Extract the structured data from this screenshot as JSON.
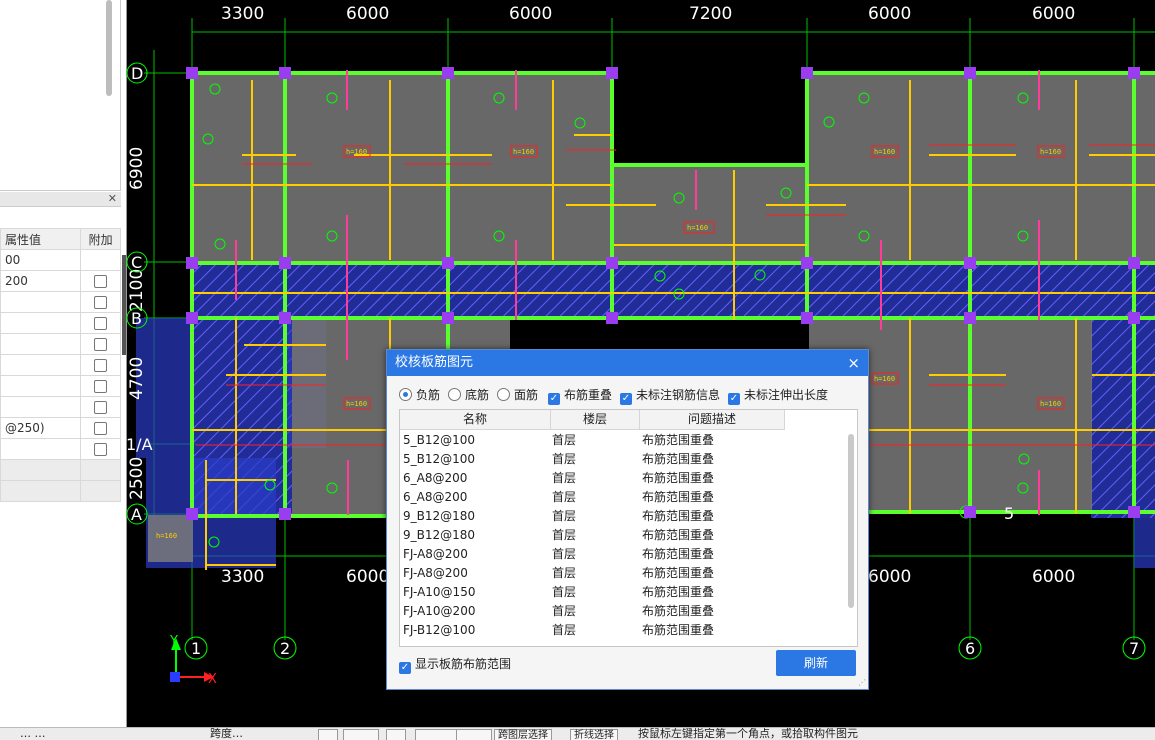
{
  "left_panel": {
    "header": {
      "value": "属性值",
      "extra": "附加"
    },
    "rows": [
      {
        "value": "00",
        "has_check": false
      },
      {
        "value": "200",
        "has_check": true
      },
      {
        "value": "",
        "has_check": true
      },
      {
        "value": "",
        "has_check": true
      },
      {
        "value": "",
        "has_check": true
      },
      {
        "value": "",
        "has_check": true
      },
      {
        "value": "",
        "has_check": true
      },
      {
        "value": "",
        "has_check": true
      },
      {
        "value": "@250)",
        "has_check": true
      },
      {
        "value": "",
        "has_check": true
      },
      {
        "value": "",
        "has_check": false
      },
      {
        "value": "",
        "has_check": false
      }
    ]
  },
  "drawing": {
    "top_dims": [
      "3300",
      "6000",
      "6000",
      "7200",
      "6000",
      "6000"
    ],
    "bottom_dims": [
      "3300",
      "6000",
      "6000",
      "6000"
    ],
    "left_dims": [
      "6900",
      "2100",
      "4700",
      "2500"
    ],
    "row_axes": [
      "D",
      "C",
      "B",
      "1/A",
      "A"
    ],
    "col_axes": [
      "1",
      "2",
      "6",
      "7"
    ],
    "marker_5": "5",
    "axis_y": "Y",
    "axis_x": "X",
    "tag_h160": "h=160",
    "colors": {
      "background": "#000000",
      "slab": "#7a7a7a",
      "beam": "#5cff2e",
      "rebar": "#ffcc00",
      "dim_line": "#00ff00",
      "hatch": "#2a3cc8",
      "column": "#9a3cf0"
    }
  },
  "dialog": {
    "title": "校核板筋图元",
    "close_icon": "×",
    "radios": [
      {
        "label": "负筋",
        "selected": true
      },
      {
        "label": "底筋",
        "selected": false
      },
      {
        "label": "面筋",
        "selected": false
      }
    ],
    "checks": [
      {
        "label": "布筋重叠",
        "checked": true
      },
      {
        "label": "未标注钢筋信息",
        "checked": true
      },
      {
        "label": "未标注伸出长度",
        "checked": true
      }
    ],
    "columns": [
      "名称",
      "楼层",
      "问题描述"
    ],
    "rows": [
      {
        "name": "5_B12@100",
        "floor": "首层",
        "issue": "布筋范围重叠"
      },
      {
        "name": "5_B12@100",
        "floor": "首层",
        "issue": "布筋范围重叠"
      },
      {
        "name": "6_A8@200",
        "floor": "首层",
        "issue": "布筋范围重叠"
      },
      {
        "name": "6_A8@200",
        "floor": "首层",
        "issue": "布筋范围重叠"
      },
      {
        "name": "9_B12@180",
        "floor": "首层",
        "issue": "布筋范围重叠"
      },
      {
        "name": "9_B12@180",
        "floor": "首层",
        "issue": "布筋范围重叠"
      },
      {
        "name": "FJ-A8@200",
        "floor": "首层",
        "issue": "布筋范围重叠"
      },
      {
        "name": "FJ-A8@200",
        "floor": "首层",
        "issue": "布筋范围重叠"
      },
      {
        "name": "FJ-A10@150",
        "floor": "首层",
        "issue": "布筋范围重叠"
      },
      {
        "name": "FJ-A10@200",
        "floor": "首层",
        "issue": "布筋范围重叠"
      },
      {
        "name": "FJ-B12@100",
        "floor": "首层",
        "issue": "布筋范围重叠"
      }
    ],
    "show_range": {
      "label": "显示板筋布筋范围",
      "checked": true
    },
    "refresh": "刷新"
  },
  "statusbar": {
    "left_text": "…  …",
    "layer_text": "跨度…",
    "btn_a": "跨图层选择",
    "btn_b": "折线选择",
    "hint": "按鼠标左键指定第一个角点，或拾取构件图元"
  }
}
